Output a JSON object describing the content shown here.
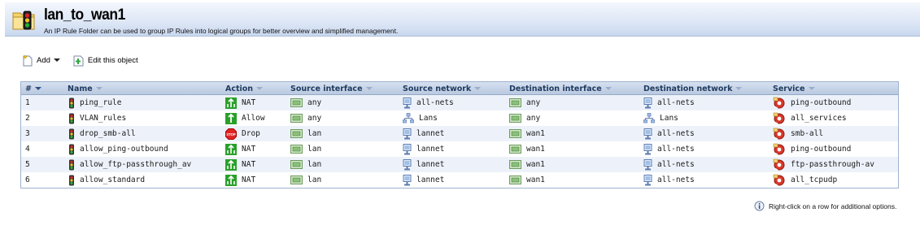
{
  "header": {
    "title": "lan_to_wan1",
    "subtitle": "An IP Rule Folder can be used to group IP Rules into logical groups for better overview and simplified management."
  },
  "toolbar": {
    "add_label": "Add",
    "edit_label": "Edit this object"
  },
  "table": {
    "columns": [
      "#",
      "Name",
      "Action",
      "Source interface",
      "Source network",
      "Destination interface",
      "Destination network",
      "Service"
    ],
    "rows": [
      {
        "num": "1",
        "name": "ping_rule",
        "action": "NAT",
        "src_if": "any",
        "src_net": "all-nets",
        "dst_if": "any",
        "dst_net": "all-nets",
        "service": "ping-outbound"
      },
      {
        "num": "2",
        "name": "VLAN_rules",
        "action": "Allow",
        "src_if": "any",
        "src_net": "Lans",
        "dst_if": "any",
        "dst_net": "Lans",
        "service": "all_services"
      },
      {
        "num": "3",
        "name": "drop_smb-all",
        "action": "Drop",
        "src_if": "lan",
        "src_net": "lannet",
        "dst_if": "wan1",
        "dst_net": "all-nets",
        "service": "smb-all"
      },
      {
        "num": "4",
        "name": "allow_ping-outbound",
        "action": "NAT",
        "src_if": "lan",
        "src_net": "lannet",
        "dst_if": "wan1",
        "dst_net": "all-nets",
        "service": "ping-outbound"
      },
      {
        "num": "5",
        "name": "allow_ftp-passthrough_av",
        "action": "NAT",
        "src_if": "lan",
        "src_net": "lannet",
        "dst_if": "wan1",
        "dst_net": "all-nets",
        "service": "ftp-passthrough-av"
      },
      {
        "num": "6",
        "name": "allow_standard",
        "action": "NAT",
        "src_if": "lan",
        "src_net": "lannet",
        "dst_if": "wan1",
        "dst_net": "all-nets",
        "service": "all_tcpudp"
      }
    ]
  },
  "footer": {
    "hint": "Right-click on a row for additional options."
  }
}
